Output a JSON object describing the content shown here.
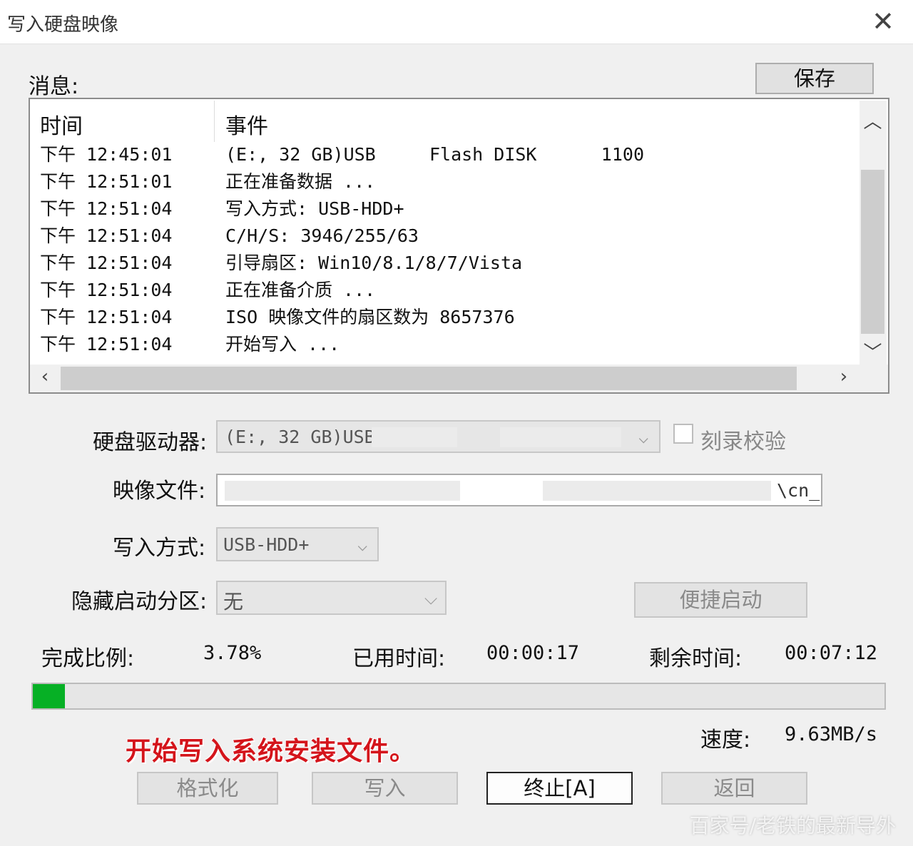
{
  "window": {
    "title": "写入硬盘映像"
  },
  "messages": {
    "label": "消息:",
    "save_button": "保存",
    "columns": [
      "时间",
      "事件"
    ],
    "rows": [
      {
        "time": "下午 12:45:01",
        "event": "(E:, 32 GB)USB     Flash DISK      1100"
      },
      {
        "time": "下午 12:51:01",
        "event": "正在准备数据 ..."
      },
      {
        "time": "下午 12:51:04",
        "event": "写入方式: USB-HDD+"
      },
      {
        "time": "下午 12:51:04",
        "event": "C/H/S: 3946/255/63"
      },
      {
        "time": "下午 12:51:04",
        "event": "引导扇区: Win10/8.1/8/7/Vista"
      },
      {
        "time": "下午 12:51:04",
        "event": "正在准备介质 ..."
      },
      {
        "time": "下午 12:51:04",
        "event": "ISO 映像文件的扇区数为 8657376"
      },
      {
        "time": "下午 12:51:04",
        "event": "开始写入 ..."
      }
    ]
  },
  "form": {
    "drive_label": "硬盘驱动器:",
    "drive_value": "(E:, 32 GB)USB",
    "verify_label": "刻录校验",
    "verify_checked": false,
    "image_label": "映像文件:",
    "image_value": "\\cn_",
    "write_mode_label": "写入方式:",
    "write_mode_value": "USB-HDD+",
    "hidden_partition_label": "隐藏启动分区:",
    "hidden_partition_value": "无",
    "quick_boot_button": "便捷启动"
  },
  "status": {
    "progress_label": "完成比例:",
    "progress_value": "3.78%",
    "progress_fraction": 0.0378,
    "elapsed_label": "已用时间:",
    "elapsed_value": "00:00:17",
    "remaining_label": "剩余时间:",
    "remaining_value": "00:07:12",
    "speed_label": "速度:",
    "speed_value": "9.63MB/s"
  },
  "annotation": "开始写入系统安装文件。",
  "buttons": {
    "format": "格式化",
    "write": "写入",
    "stop": "终止[A]",
    "back": "返回"
  },
  "watermark": "百家号/老铁的最新导外",
  "colors": {
    "progress_fill": "#06b025",
    "annotation": "#d4141b"
  }
}
